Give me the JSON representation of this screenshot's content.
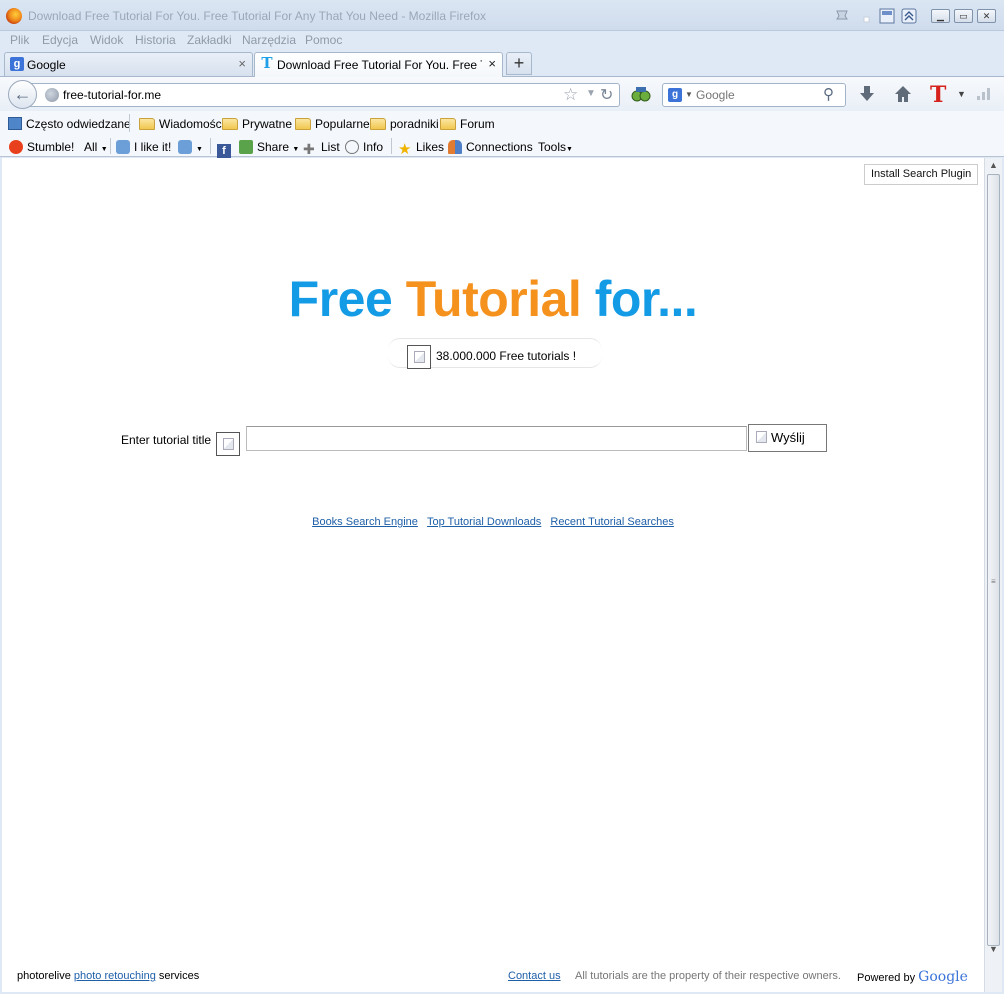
{
  "window": {
    "title": "Download Free Tutorial For You. Free Tutorial For Any That You Need - Mozilla Firefox"
  },
  "menu": [
    "Plik",
    "Edycja",
    "Widok",
    "Historia",
    "Zakładki",
    "Narzędzia",
    "Pomoc"
  ],
  "tabs": [
    {
      "label": "Google",
      "favicon": "google-icon"
    },
    {
      "label": "Download Free Tutorial For You. Free Tu...",
      "favicon": "tutorial-t-icon",
      "active": true
    }
  ],
  "navbar": {
    "url": "free-tutorial-for.me",
    "search_placeholder": "Google"
  },
  "bookmarks": [
    "Często odwiedzane",
    "Wiadomości",
    "Prywatne",
    "Popularne",
    "poradniki",
    "Forum"
  ],
  "stumble_toolbar": {
    "stumble": "Stumble!",
    "all": "All",
    "like": "I like it!",
    "share": "Share",
    "list": "List",
    "info": "Info",
    "likes": "Likes",
    "connections": "Connections",
    "tools": "Tools"
  },
  "page": {
    "install_button": "Install Search Plugin",
    "hero_free": "Free",
    "hero_tutorial": "Tutorial",
    "hero_for": "for...",
    "count_text": "38.000.000 Free tutorials !",
    "input_label": "Enter tutorial title",
    "send_button": "Wyślij",
    "links": [
      "Books Search Engine",
      "Top Tutorial Downloads",
      "Recent Tutorial Searches"
    ],
    "footer": {
      "left_prefix": "photorelive",
      "left_link": "photo retouching",
      "left_suffix": "services",
      "contact": "Contact us",
      "rights": "All tutorials are the property of their respective owners.",
      "powered_by": "Powered by",
      "google": "Google"
    }
  },
  "colors": {
    "hero_blue": "#149be6",
    "hero_orange": "#f5921e",
    "link_blue": "#1e5fa8"
  }
}
